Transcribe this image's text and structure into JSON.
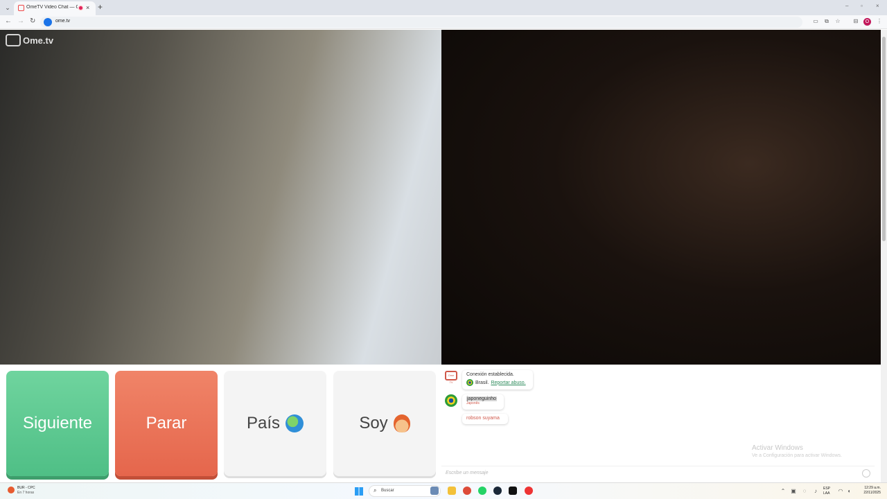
{
  "browser": {
    "tab_title": "OmeTV Video Chat — Ome",
    "tab_close": "×",
    "new_tab": "+",
    "url": "ome.tv",
    "profile_initial": "O",
    "back": "←",
    "forward": "→",
    "reload": "↻",
    "minimize": "–",
    "maximize": "▫",
    "close": "×"
  },
  "video": {
    "logo_text": "Ome.tv"
  },
  "controls": {
    "next_label": "Siguiente",
    "stop_label": "Parar",
    "country_label": "País",
    "gender_label": "Soy"
  },
  "chat": {
    "system_icon_text": "Ome TV",
    "connection_text": "Conexión establecida.",
    "partner_country": "Brasil.",
    "report_link": "Reportar abuso.",
    "partner_name": "japoneguinho",
    "partner_subtitle": "Japonês",
    "message_1": "robson suyama",
    "input_placeholder": "Escribe un mensaje",
    "watermark_title": "Activar Windows",
    "watermark_subtitle": "Ve a Configuración para activar Windows."
  },
  "taskbar": {
    "weather_title": "BUR - CPC",
    "weather_subtitle": "En 7 horas",
    "search_placeholder": "Buscar",
    "language_line1": "ESP",
    "language_line2": "LAA",
    "time": "12:29 a.m.",
    "date": "22/11/2025"
  },
  "colors": {
    "next": "#5ac990",
    "stop": "#ea6f54",
    "neutral": "#f4f4f4",
    "chat_accent": "#d0584a",
    "link": "#2b8a5a"
  }
}
